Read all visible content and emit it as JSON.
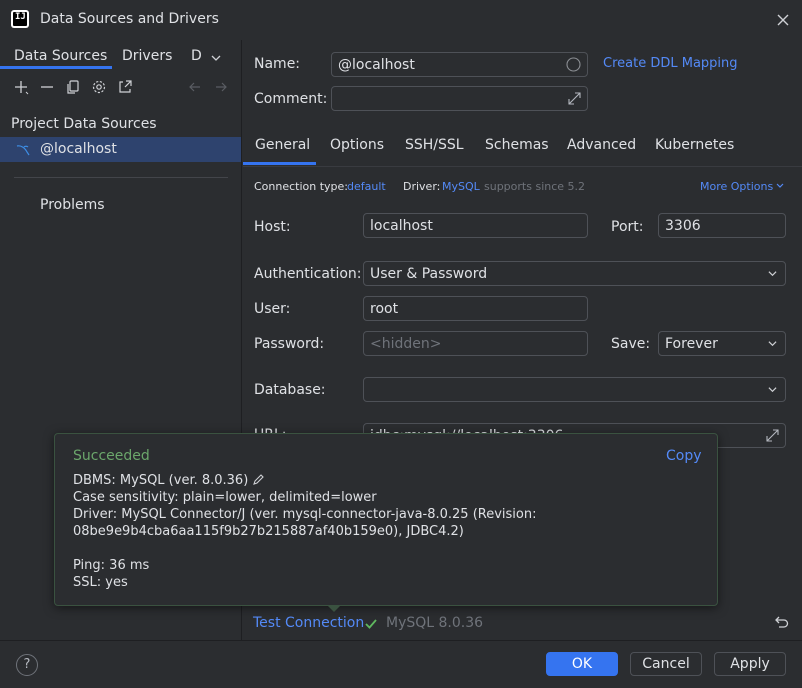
{
  "window": {
    "title": "Data Sources and Drivers"
  },
  "left": {
    "tabs": [
      {
        "label": "Data Sources"
      },
      {
        "label": "Drivers"
      },
      {
        "label": "D"
      }
    ],
    "section_title": "Project Data Sources",
    "items": [
      {
        "label": "@localhost"
      }
    ],
    "problems_label": "Problems"
  },
  "form": {
    "name_label": "Name:",
    "name_value": "@localhost",
    "create_ddl": "Create DDL Mapping",
    "comment_label": "Comment:",
    "comment_value": "",
    "tabs": [
      {
        "label": "General"
      },
      {
        "label": "Options"
      },
      {
        "label": "SSH/SSL"
      },
      {
        "label": "Schemas"
      },
      {
        "label": "Advanced"
      },
      {
        "label": "Kubernetes"
      }
    ],
    "conn_type_label": "Connection type:",
    "conn_type_value": "default",
    "driver_label": "Driver:",
    "driver_value": "MySQL",
    "driver_note": "supports since 5.2",
    "more_options": "More Options",
    "host_label": "Host:",
    "host_value": "localhost",
    "port_label": "Port:",
    "port_value": "3306",
    "auth_label": "Authentication:",
    "auth_value": "User & Password",
    "user_label": "User:",
    "user_value": "root",
    "password_label": "Password:",
    "password_placeholder": "<hidden>",
    "save_label": "Save:",
    "save_value": "Forever",
    "database_label": "Database:",
    "database_value": "",
    "url_label": "URL:",
    "url_value": "jdbc:mysql://localhost:3306"
  },
  "popup": {
    "status": "Succeeded",
    "copy": "Copy",
    "lines": [
      "DBMS: MySQL (ver. 8.0.36)",
      "Case sensitivity: plain=lower, delimited=lower",
      "Driver: MySQL Connector/J (ver. mysql-connector-java-8.0.25 (Revision:",
      "08be9e9b4cba6aa115f9b27b215887af40b159e0), JDBC4.2)",
      "Ping: 36 ms",
      "SSL: yes"
    ]
  },
  "test": {
    "label": "Test Connection",
    "result": "MySQL 8.0.36"
  },
  "footer": {
    "help": "?",
    "ok": "OK",
    "cancel": "Cancel",
    "apply": "Apply"
  },
  "colors": {
    "accent": "#3574f0",
    "link": "#548af7",
    "success": "#6ba66b"
  }
}
